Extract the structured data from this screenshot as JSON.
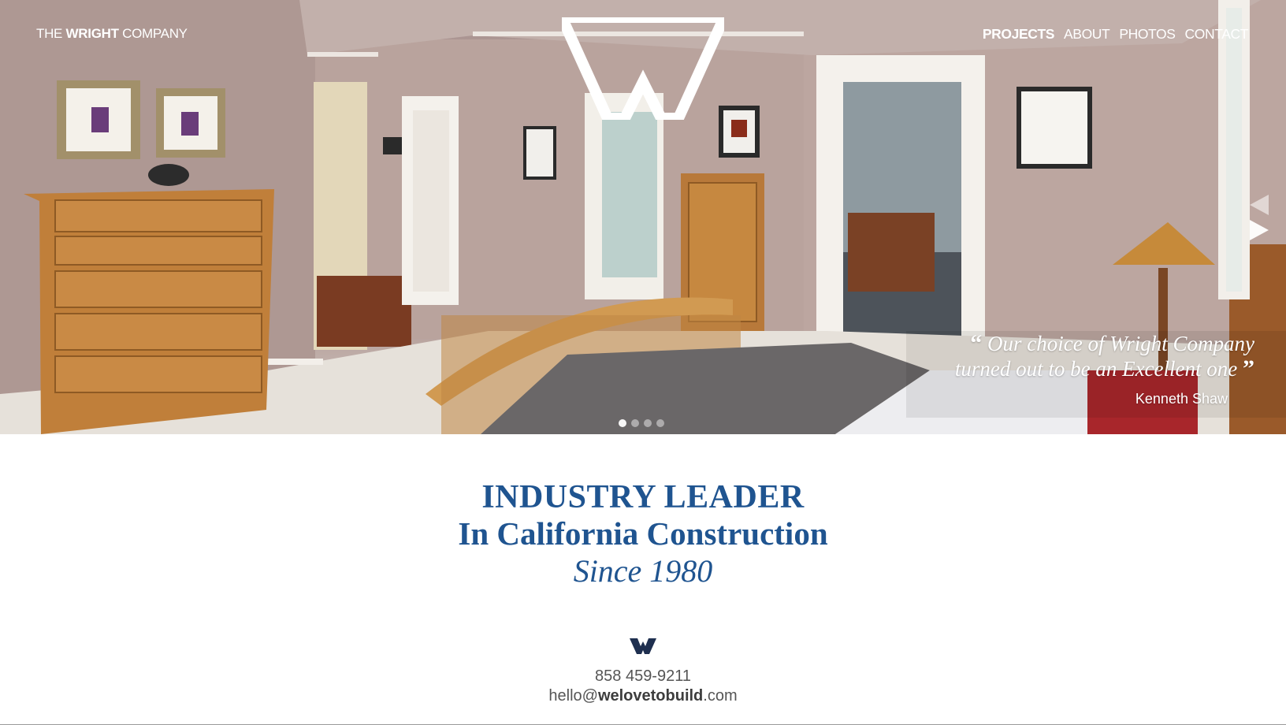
{
  "header": {
    "brand": {
      "prefix": "THE",
      "name": "WRIGHT",
      "suffix": "COMPANY"
    },
    "nav": [
      {
        "label": "PROJECTS",
        "active": true
      },
      {
        "label": "ABOUT",
        "active": false
      },
      {
        "label": "PHOTOS",
        "active": false
      },
      {
        "label": "CONTACT",
        "active": false
      }
    ]
  },
  "slider": {
    "testimonial": {
      "line1": "Our choice of Wright Company",
      "line2": "turned out to be an Excellent one",
      "open_mark": "“",
      "close_mark": "”",
      "author": "Kenneth Shaw"
    },
    "slide_count": 4,
    "active_slide": 1,
    "prev_icon": "triangle-left-icon",
    "next_icon": "triangle-right-icon"
  },
  "headline": {
    "line1": "INDUSTRY LEADER",
    "line2": "In California Construction",
    "line3": "Since 1980"
  },
  "contact": {
    "phone": "858 459-9211",
    "email_user": "hello@",
    "email_domain": "welovetobuild",
    "email_tld": ".com"
  },
  "colors": {
    "accent": "#1f5490",
    "logo_dark": "#1e2f4f",
    "text_gray": "#555555"
  }
}
